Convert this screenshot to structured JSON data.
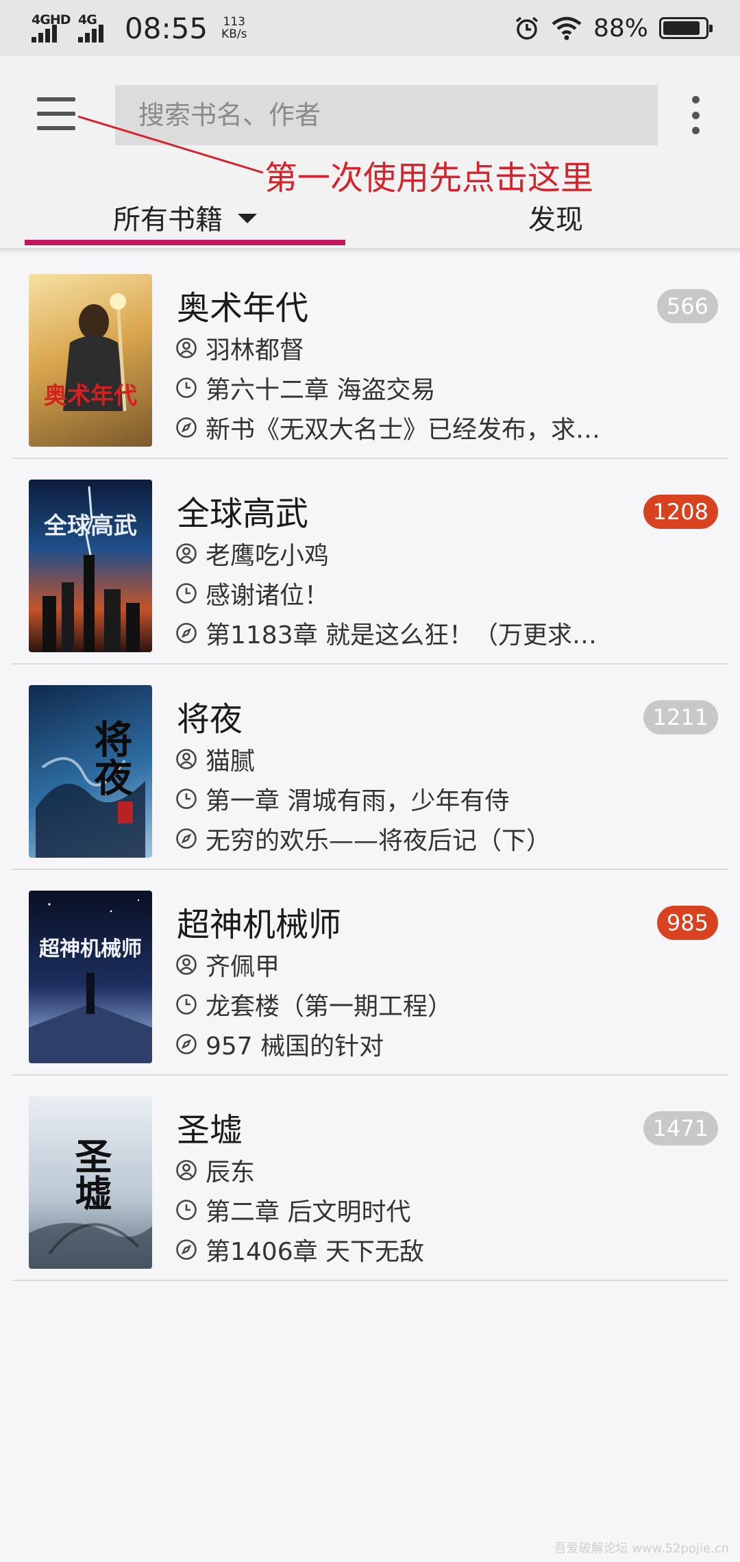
{
  "status_bar": {
    "network_1": "4GHD",
    "network_2": "4G",
    "time": "08:55",
    "speed_value": "113",
    "speed_unit": "KB/s",
    "battery_percent": "88%",
    "battery_level": 0.88
  },
  "toolbar": {
    "search_placeholder": "搜索书名、作者",
    "annotation": "第一次使用先点击这里"
  },
  "tabs": [
    {
      "label": "所有书籍",
      "selected": true
    },
    {
      "label": "发现",
      "selected": false
    }
  ],
  "colors": {
    "accent": "#c2185b",
    "annotation": "#d6232b",
    "badge_gray": "#c8c8c8",
    "badge_red": "#d9421f"
  },
  "books": [
    {
      "cover_title": "奥术年代",
      "title": "奥术年代",
      "author": "羽林都督",
      "last_read": "第六十二章 海盗交易",
      "latest": "新书《无双大名士》已经发布，求…",
      "count": "566",
      "highlight": false
    },
    {
      "cover_title": "全球高武",
      "title": "全球高武",
      "author": "老鹰吃小鸡",
      "last_read": "感谢诸位！",
      "latest": "第1183章 就是这么狂！（万更求…",
      "count": "1208",
      "highlight": true
    },
    {
      "cover_title": "将夜",
      "title": "将夜",
      "author": "猫腻",
      "last_read": "第一章 渭城有雨，少年有侍",
      "latest": "无穷的欢乐——将夜后记（下）",
      "count": "1211",
      "highlight": false
    },
    {
      "cover_title": "超神机械师",
      "title": "超神机械师",
      "author": "齐佩甲",
      "last_read": "龙套楼（第一期工程）",
      "latest": "957 械国的针对",
      "count": "985",
      "highlight": true
    },
    {
      "cover_title": "圣墟",
      "title": "圣墟",
      "author": "辰东",
      "last_read": "第二章 后文明时代",
      "latest": "第1406章 天下无敌",
      "count": "1471",
      "highlight": false
    }
  ],
  "icons": {
    "author": "person-circle-icon",
    "last_read": "clock-icon",
    "latest": "compass-icon"
  },
  "watermark": "吾爱破解论坛 www.52pojie.cn"
}
